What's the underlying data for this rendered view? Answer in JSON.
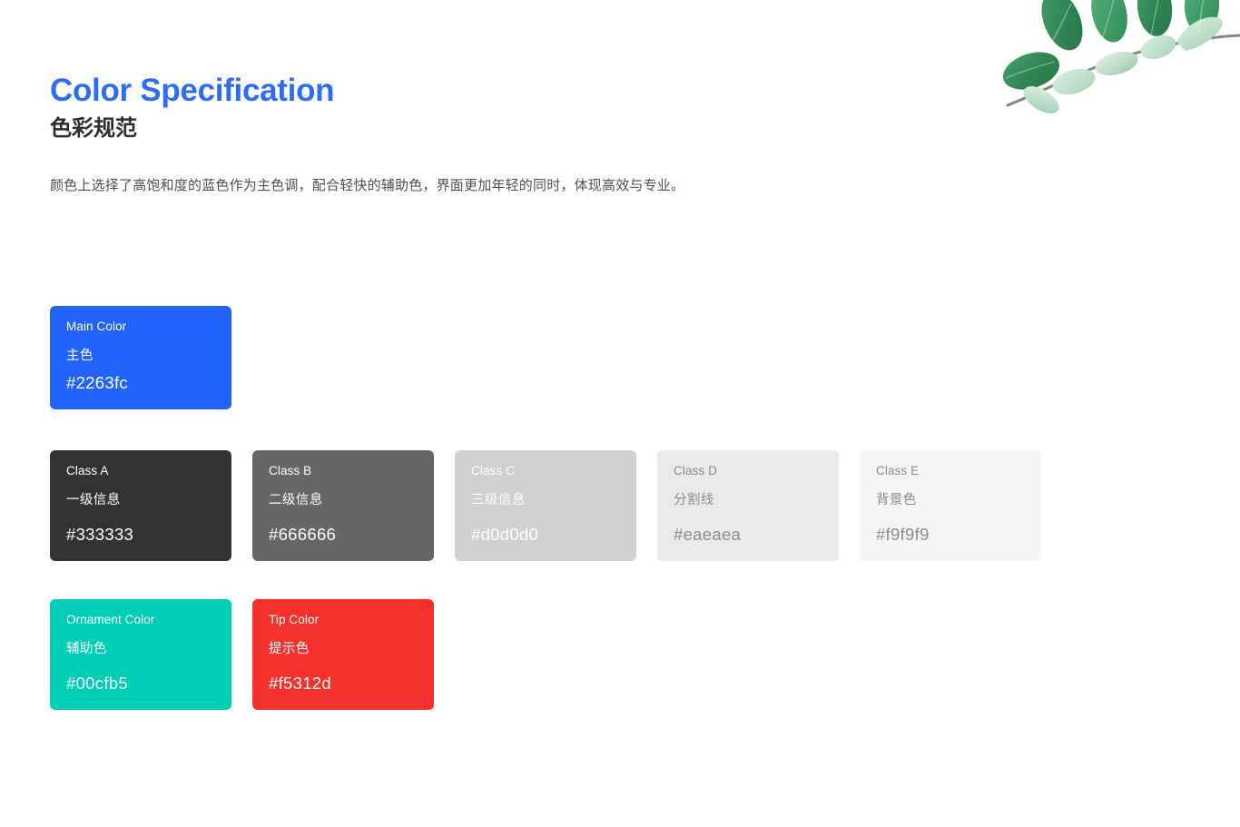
{
  "header": {
    "title": "Color Specification",
    "subtitle": "色彩规范",
    "description": "颜色上选择了高饱和度的蓝色作为主色调，配合轻快的辅助色，界面更加年轻的同时，体现高效与专业。",
    "title_color": "#2d6cf6",
    "subtitle_color": "#2e2e2e",
    "description_color": "#4f4f4f"
  },
  "decoration": {
    "name": "plant-branch-illustration",
    "leaf_colors": [
      "#2f8b55",
      "#3f9e63",
      "#7fc39a",
      "#b9dcc6",
      "#cfe8d6"
    ],
    "stem_color": "#6f7d72"
  },
  "palette": {
    "main_row": [
      {
        "en": "Main Color",
        "cn": "主色",
        "hex": "#2263fc",
        "bg": "#2263fc",
        "tone": "on-dark",
        "key": "main-color"
      }
    ],
    "neutral_row": [
      {
        "en": "Class A",
        "cn": "一级信息",
        "hex": "#333333",
        "bg": "#333333",
        "tone": "on-dark",
        "key": "class-a"
      },
      {
        "en": "Class B",
        "cn": "二级信息",
        "hex": "#666666",
        "bg": "#666666",
        "tone": "on-dark",
        "key": "class-b"
      },
      {
        "en": "Class C",
        "cn": "三级信息",
        "hex": "#d0d0d0",
        "bg": "#d0d0d0",
        "tone": "on-dark",
        "key": "class-c"
      },
      {
        "en": "Class D",
        "cn": "分割线",
        "hex": "#eaeaea",
        "bg": "#eaeaea",
        "tone": "on-light",
        "key": "class-d"
      },
      {
        "en": "Class E",
        "cn": "背景色",
        "hex": "#f9f9f9",
        "bg": "#f5f5f5",
        "tone": "on-light",
        "key": "class-e"
      }
    ],
    "accent_row": [
      {
        "en": "Ornament Color",
        "cn": "辅助色",
        "hex": "#00cfb5",
        "bg": "#00cfb5",
        "tone": "on-dark",
        "key": "ornament-color"
      },
      {
        "en": "Tip Color",
        "cn": "提示色",
        "hex": "#f5312d",
        "bg": "#f5312d",
        "tone": "on-dark",
        "key": "tip-color"
      }
    ]
  }
}
